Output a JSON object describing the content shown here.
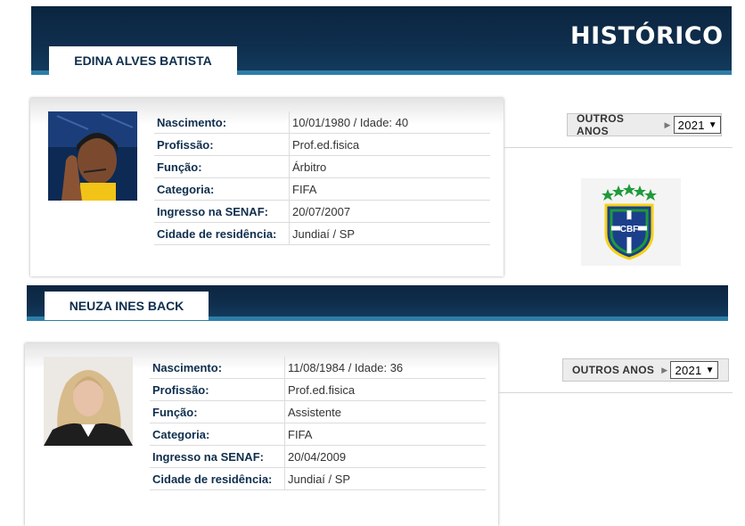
{
  "header": {
    "title": "HISTÓRICO"
  },
  "referees": [
    {
      "name": "EDINA ALVES BATISTA",
      "photo_alt": "edina-photo",
      "fields": [
        {
          "label": "Nascimento:",
          "value": "10/01/1980 / Idade: 40"
        },
        {
          "label": "Profissão:",
          "value": "Prof.ed.fisica"
        },
        {
          "label": "Função:",
          "value": "Árbitro"
        },
        {
          "label": "Categoria:",
          "value": "FIFA"
        },
        {
          "label": "Ingresso na SENAF:",
          "value": "20/07/2007"
        },
        {
          "label": "Cidade de residência:",
          "value": "Jundiaí / SP"
        }
      ],
      "outros_anos_label": "OUTROS ANOS",
      "year_selected": "2021"
    },
    {
      "name": "NEUZA INES BACK",
      "photo_alt": "neuza-photo",
      "fields": [
        {
          "label": "Nascimento:",
          "value": "11/08/1984 / Idade: 36"
        },
        {
          "label": "Profissão:",
          "value": "Prof.ed.fisica"
        },
        {
          "label": "Função:",
          "value": "Assistente"
        },
        {
          "label": "Categoria:",
          "value": "FIFA"
        },
        {
          "label": "Ingresso na SENAF:",
          "value": "20/04/2009"
        },
        {
          "label": "Cidade de residência:",
          "value": "Jundiaí / SP"
        }
      ],
      "outros_anos_label": "OUTROS ANOS",
      "year_selected": "2021"
    }
  ],
  "logo": {
    "text": "CBF",
    "icon": "cbf-crest-icon"
  },
  "colors": {
    "navy": "#0f2e4d",
    "stripe": "#2e7ea8",
    "cbf_blue": "#1b3f8b",
    "cbf_yellow": "#f5d218",
    "cbf_green": "#1f9a3a"
  }
}
